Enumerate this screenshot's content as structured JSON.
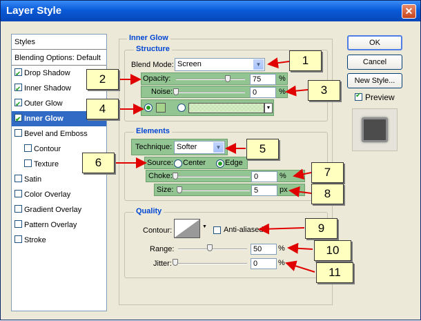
{
  "window": {
    "title": "Layer Style",
    "close": "✕"
  },
  "styles_panel": {
    "header": "Styles",
    "items": [
      {
        "label": "Blending Options: Default",
        "checkbox": false,
        "checked": false
      },
      {
        "label": "Drop Shadow",
        "checkbox": true,
        "checked": true
      },
      {
        "label": "Inner Shadow",
        "checkbox": true,
        "checked": true
      },
      {
        "label": "Outer Glow",
        "checkbox": true,
        "checked": true
      },
      {
        "label": "Inner Glow",
        "checkbox": true,
        "checked": true,
        "selected": true
      },
      {
        "label": "Bevel and Emboss",
        "checkbox": true,
        "checked": false
      },
      {
        "label": "Contour",
        "checkbox": true,
        "checked": false,
        "sub": true
      },
      {
        "label": "Texture",
        "checkbox": true,
        "checked": false,
        "sub": true
      },
      {
        "label": "Satin",
        "checkbox": true,
        "checked": false
      },
      {
        "label": "Color Overlay",
        "checkbox": true,
        "checked": false
      },
      {
        "label": "Gradient Overlay",
        "checkbox": true,
        "checked": false
      },
      {
        "label": "Pattern Overlay",
        "checkbox": true,
        "checked": false
      },
      {
        "label": "Stroke",
        "checkbox": true,
        "checked": false
      }
    ]
  },
  "inner_glow": {
    "title": "Inner Glow",
    "structure": {
      "title": "Structure",
      "blend_mode_label": "Blend Mode:",
      "blend_mode_value": "Screen",
      "opacity_label": "Opacity:",
      "opacity_value": "75",
      "opacity_percent": 75,
      "noise_label": "Noise:",
      "noise_value": "0",
      "noise_percent": 0,
      "unit_percent": "%"
    },
    "elements": {
      "title": "Elements",
      "technique_label": "Technique:",
      "technique_value": "Softer",
      "source_label": "Source:",
      "source_center": "Center",
      "source_edge": "Edge",
      "choke_label": "Choke:",
      "choke_value": "0",
      "choke_percent": 0,
      "size_label": "Size:",
      "size_value": "5",
      "size_unit": "px"
    },
    "quality": {
      "title": "Quality",
      "contour_label": "Contour:",
      "anti_aliased_label": "Anti-aliased",
      "range_label": "Range:",
      "range_value": "50",
      "range_percent": 50,
      "jitter_label": "Jitter:",
      "jitter_value": "0",
      "jitter_percent": 0,
      "unit_percent": "%"
    }
  },
  "buttons": {
    "ok": "OK",
    "cancel": "Cancel",
    "new_style": "New Style...",
    "preview": "Preview"
  },
  "callouts": [
    "1",
    "2",
    "3",
    "4",
    "5",
    "6",
    "7",
    "8",
    "9",
    "10",
    "11"
  ],
  "colors": {
    "highlight": "#93c593",
    "accent": "#0046d5",
    "selection": "#316ac5",
    "callout": "#ffffc0",
    "arrow": "#e00000"
  }
}
